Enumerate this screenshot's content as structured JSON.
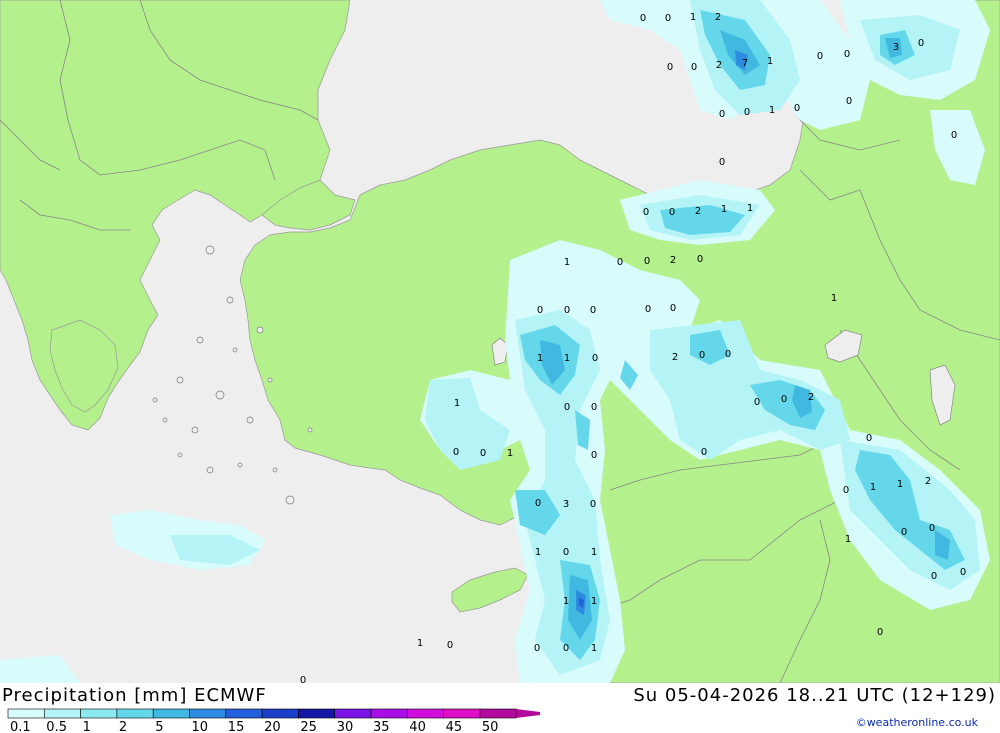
{
  "footer": {
    "title": "Precipitation [mm] ECMWF",
    "time": "Su 05-04-2026 18..21 UTC (12+129)",
    "credit": "©weatheronline.co.uk"
  },
  "legend": {
    "classes": [
      {
        "label": "0.1",
        "color": "#d8fbfc"
      },
      {
        "label": "0.5",
        "color": "#b4f3f6"
      },
      {
        "label": "1",
        "color": "#8ce9f0"
      },
      {
        "label": "2",
        "color": "#64d8ea"
      },
      {
        "label": "5",
        "color": "#41b8df"
      },
      {
        "label": "10",
        "color": "#2d8be0"
      },
      {
        "label": "15",
        "color": "#2460dc"
      },
      {
        "label": "20",
        "color": "#1c3fcb"
      },
      {
        "label": "25",
        "color": "#1616a6"
      },
      {
        "label": "30",
        "color": "#7c12e6"
      },
      {
        "label": "35",
        "color": "#a80ee6"
      },
      {
        "label": "40",
        "color": "#d20edc"
      },
      {
        "label": "45",
        "color": "#e20fc8"
      },
      {
        "label": "50",
        "color": "#b20a9c"
      }
    ]
  },
  "map": {
    "colors": {
      "land": "#b4f08c",
      "sea": "#eeeeee",
      "border": "#888888"
    },
    "values": [
      "0",
      "0",
      "1",
      "2",
      "0",
      "0",
      "2",
      "7",
      "1",
      "0",
      "0",
      "3",
      "0",
      "0",
      "0",
      "1",
      "0",
      "0",
      "0",
      "0",
      "0",
      "0",
      "2",
      "1",
      "1",
      "1",
      "0",
      "0",
      "2",
      "0",
      "1",
      "0",
      "0",
      "0",
      "0",
      "0",
      "1",
      "1",
      "0",
      "2",
      "0",
      "0",
      "0",
      "0",
      "2",
      "1",
      "0",
      "0",
      "0",
      "0",
      "1",
      "0",
      "0",
      "0",
      "2",
      "0",
      "1",
      "1",
      "0",
      "3",
      "0",
      "0",
      "0",
      "1",
      "1",
      "0",
      "1",
      "0",
      "0",
      "1",
      "1",
      "0",
      "1",
      "0",
      "0",
      "0",
      "1",
      "0",
      "0",
      "0"
    ]
  }
}
